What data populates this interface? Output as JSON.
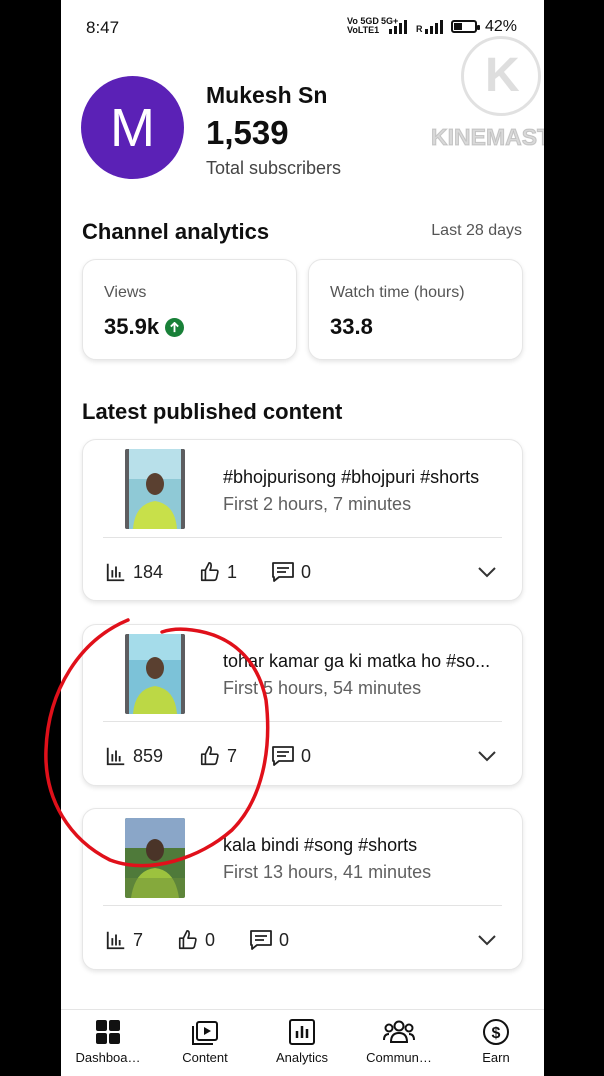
{
  "status_bar": {
    "time": "8:47",
    "net1": "Vo 5GD",
    "net2": "VoLTE1",
    "net3": "5G+",
    "net4": "R",
    "battery": "42%",
    "battery_level": 0.42
  },
  "watermark": {
    "letter": "K",
    "text": "KINEMASTER"
  },
  "channel": {
    "avatar_letter": "M",
    "name": "Mukesh Sn",
    "subscribers": "1,539",
    "subscribers_label": "Total subscribers",
    "avatar_color": "#5b21b6"
  },
  "analytics": {
    "title": "Channel analytics",
    "period": "Last 28 days",
    "views_label": "Views",
    "views_value": "35.9k",
    "watch_label": "Watch time (hours)",
    "watch_value": "33.8",
    "up_color": "#188038"
  },
  "latest": {
    "title": "Latest published content",
    "videos": [
      {
        "title": "#bhojpurisong #bhojpuri #shorts",
        "time": "First 2 hours, 7 minutes",
        "views": "184",
        "likes": "1",
        "comments": "0"
      },
      {
        "title": "tohar kamar ga ki matka ho #so...",
        "time": "First 5 hours, 54 minutes",
        "views": "859",
        "likes": "7",
        "comments": "0"
      },
      {
        "title": "kala bindi #song #shorts",
        "time": "First 13 hours, 41 minutes",
        "views": "7",
        "likes": "0",
        "comments": "0"
      }
    ]
  },
  "nav": {
    "items": [
      {
        "label": "Dashboa…",
        "icon": "dashboard-icon"
      },
      {
        "label": "Content",
        "icon": "content-icon"
      },
      {
        "label": "Analytics",
        "icon": "analytics-icon"
      },
      {
        "label": "Commun…",
        "icon": "community-icon"
      },
      {
        "label": "Earn",
        "icon": "earn-icon"
      }
    ]
  },
  "annotation_color": "#e0101a"
}
